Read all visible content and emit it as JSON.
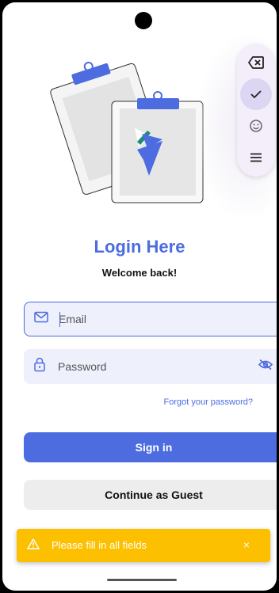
{
  "login": {
    "title": "Login Here",
    "subtitle": "Welcome back!"
  },
  "email_field": {
    "placeholder": "Email",
    "value": "",
    "icon": "mail-icon"
  },
  "password_field": {
    "placeholder": "Password",
    "value": "",
    "icon": "lock-icon",
    "toggle_icon": "eye-off-icon"
  },
  "forgot_password": "Forgot your password?",
  "buttons": {
    "sign_in": "Sign in",
    "guest": "Continue as Guest"
  },
  "snackbar": {
    "message": "Please fill in all fields",
    "close": "×",
    "icon": "warning-icon"
  },
  "keyboard_toolbar": {
    "icons": [
      "backspace-icon",
      "check-icon",
      "emoji-icon",
      "menu-icon"
    ],
    "active": "check-icon"
  },
  "colors": {
    "accent": "#4c6ce0",
    "field_bg": "#eef0fb",
    "snackbar": "#fcc000",
    "guest_bg": "#ededed"
  }
}
